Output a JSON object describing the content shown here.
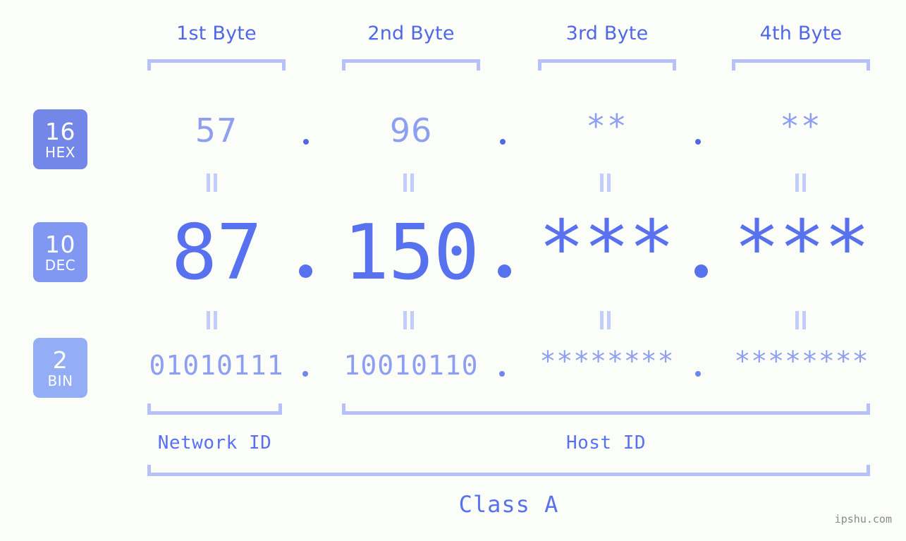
{
  "background": "#fbfdf8",
  "accent": "#5871ef",
  "accent_light": "#8e9ff2",
  "bracket_color": "#b6c1fa",
  "byte_headers": [
    {
      "label": "1st Byte"
    },
    {
      "label": "2nd Byte"
    },
    {
      "label": "3rd Byte"
    },
    {
      "label": "4th Byte"
    }
  ],
  "radix_badges": [
    {
      "number": "16",
      "name": "HEX",
      "color": "#7287e8"
    },
    {
      "number": "10",
      "name": "DEC",
      "color": "#8098f2"
    },
    {
      "number": "2",
      "name": "BIN",
      "color": "#93aef5"
    }
  ],
  "rows": {
    "hex": {
      "values": [
        "57",
        "96",
        "**",
        "**"
      ]
    },
    "dec": {
      "values": [
        "87",
        "150",
        "***",
        "***"
      ]
    },
    "bin": {
      "values": [
        "01010111",
        "10010110",
        "********",
        "********"
      ]
    }
  },
  "separator": ".",
  "equality_symbol": "=",
  "footer": {
    "network_id_label": "Network ID",
    "host_id_label": "Host ID",
    "class_label": "Class A"
  },
  "watermark": "ipshu.com"
}
